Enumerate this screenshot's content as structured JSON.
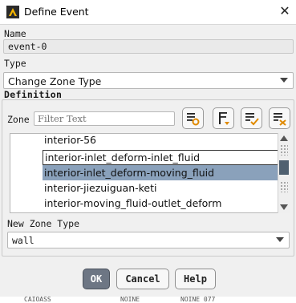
{
  "window": {
    "title": "Define Event",
    "app_icon": "ansys-fluent-icon",
    "close_icon": "close-icon"
  },
  "form": {
    "name_label": "Name",
    "name_value": "event-0",
    "type_label": "Type",
    "type_value": "Change Zone Type",
    "definition_label": "Definition",
    "zone_label": "Zone",
    "filter_placeholder": "Filter Text",
    "tool_buttons": [
      {
        "icon": "select-zone-icon"
      },
      {
        "icon": "filter-list-icon"
      },
      {
        "icon": "select-all-icon"
      },
      {
        "icon": "deselect-all-icon"
      }
    ],
    "zones": [
      {
        "label": "interior-56",
        "state": "normal"
      },
      {
        "label": "interior-inlet_deform-inlet_fluid",
        "state": "focused"
      },
      {
        "label": "interior-inlet_deform-moving_fluid",
        "state": "selected"
      },
      {
        "label": "interior-jiezuiguan-keti",
        "state": "normal"
      },
      {
        "label": "interior-moving_fluid-outlet_deform",
        "state": "normal"
      }
    ],
    "new_zone_type_label": "New Zone Type",
    "new_zone_type_value": "wall"
  },
  "buttons": {
    "ok": "OK",
    "cancel": "Cancel",
    "help": "Help"
  },
  "background_strip": {
    "left_text": "CAIOASS",
    "mid_text": "NOINE",
    "right_text": "NOINE 077"
  },
  "colors": {
    "selected_row": "#8aa1bb",
    "ok_button": "#6d7684",
    "scroll_thumb": "#4f6070"
  }
}
